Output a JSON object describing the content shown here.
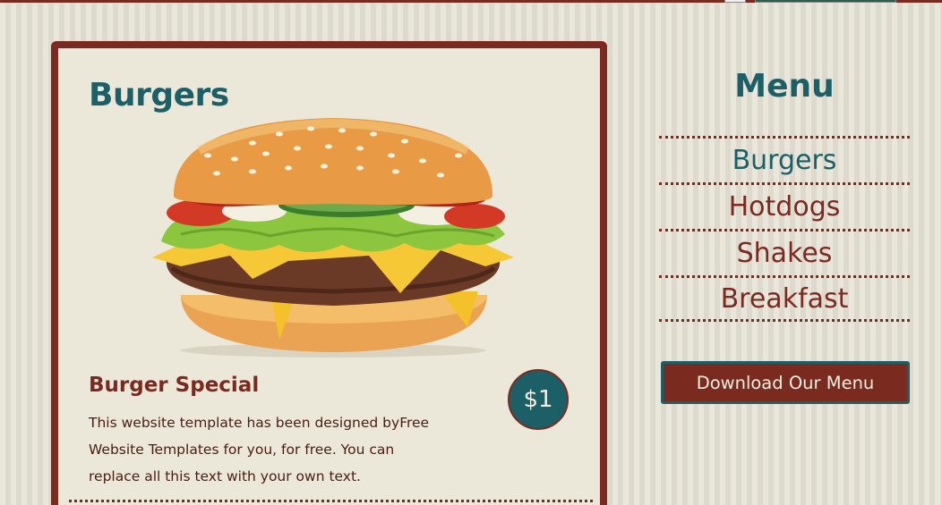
{
  "card": {
    "title": "Burgers",
    "special": {
      "title": "Burger Special",
      "description": "This website template has been designed byFree Website Templates for you, for free. You can replace all this text with your own text.",
      "price": "$1"
    }
  },
  "sidebar": {
    "title": "Menu",
    "items": [
      {
        "label": "Burgers",
        "active": true
      },
      {
        "label": "Hotdogs",
        "active": false
      },
      {
        "label": "Shakes",
        "active": false
      },
      {
        "label": "Breakfast",
        "active": false
      }
    ],
    "download_label": "Download Our Menu"
  },
  "colors": {
    "brand_red": "#7b2a20",
    "teal": "#1d5f66",
    "cream": "#ebe8da"
  }
}
